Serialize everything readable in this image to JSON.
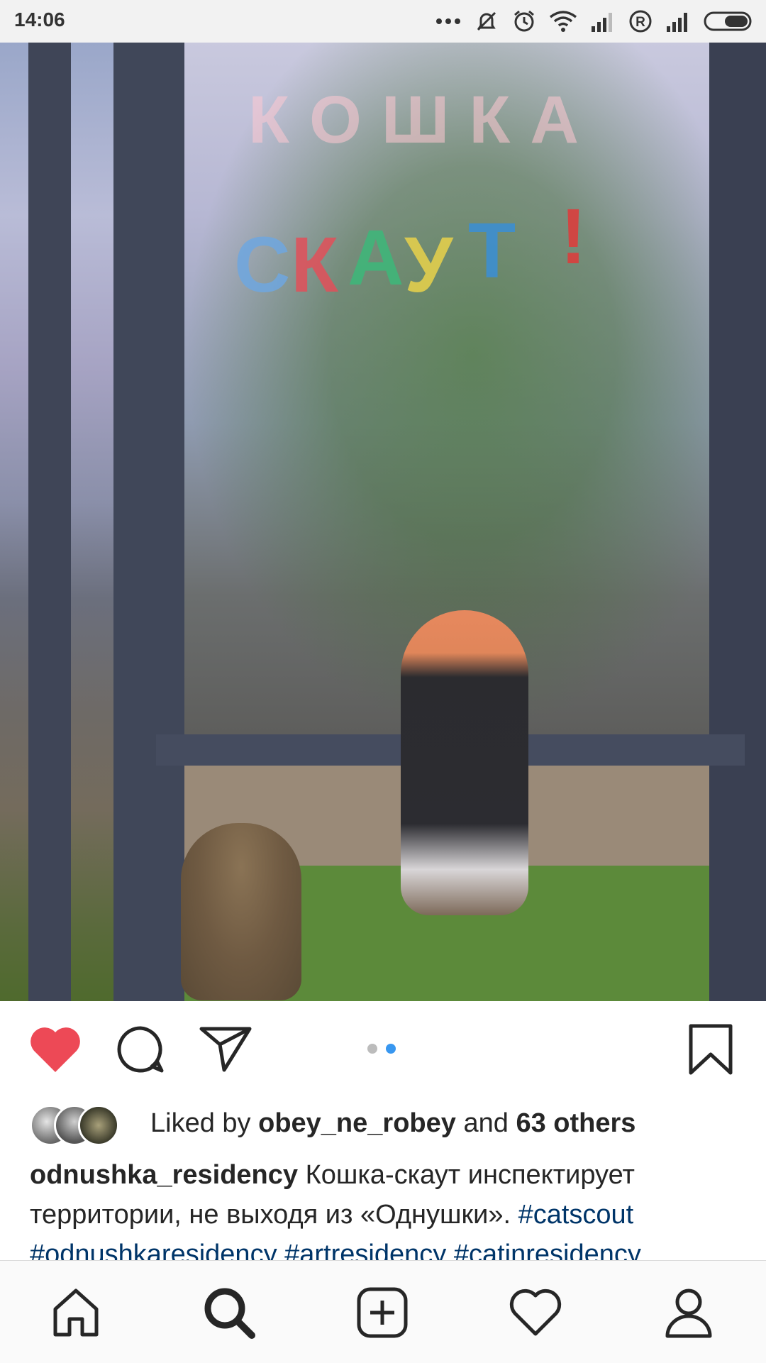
{
  "status_bar": {
    "time": "14:06",
    "icons": [
      "more-dots-icon",
      "mute-icon",
      "alarm-icon",
      "wifi-icon",
      "signal-icon",
      "registered-icon",
      "signal-icon",
      "battery-icon"
    ]
  },
  "post": {
    "photo": {
      "alt_marks": {
        "top_word": "КОШКА",
        "second_word": "СКАУТ!"
      }
    },
    "actions": {
      "like_icon": "heart-filled-icon",
      "comment_icon": "comment-icon",
      "share_icon": "paper-plane-icon",
      "save_icon": "bookmark-icon",
      "liked": true,
      "carousel_count": 2,
      "carousel_active_index": 1
    },
    "likes": {
      "prefix": "Liked by",
      "user": "obey_ne_robey",
      "middle": "and",
      "others": "63 others"
    },
    "caption": {
      "username": "odnushka_residency",
      "text": "Кошка-скаут инспектирует территории, не выходя из «Однушки».",
      "hashtags": [
        "#catscout",
        "#odnushkaresidency",
        "#artresidency",
        "#catinresidency"
      ]
    }
  },
  "bottom_nav": {
    "items": [
      "home-icon",
      "search-icon",
      "add-post-icon",
      "activity-heart-icon",
      "profile-icon"
    ],
    "active": "search-icon"
  },
  "colors": {
    "like": "#ed4956",
    "carousel_active": "#3897f0",
    "hashtag": "#003569"
  }
}
